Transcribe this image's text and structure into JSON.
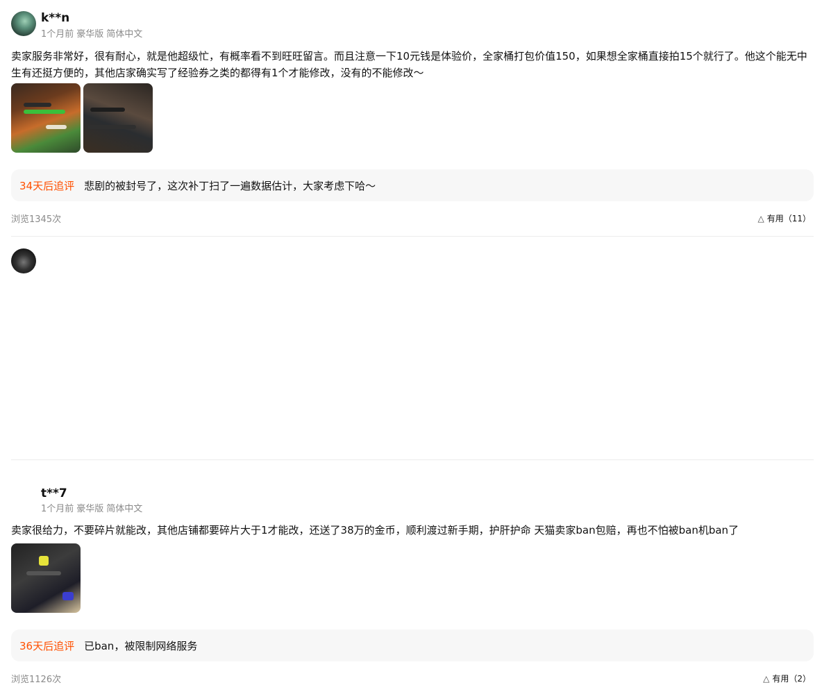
{
  "reviews": [
    {
      "username": "k**n",
      "time": "1个月前",
      "sku": "豪华版",
      "language": "简体中文",
      "content": "卖家服务非常好，很有耐心，就是他超级忙，有概率看不到旺旺留言。而且注意一下10元钱是体验价，全家桶打包价值150，如果想全家桶直接拍15个就行了。他这个能无中生有还挺方便的，其他店家确实写了经验券之类的都得有1个才能修改，没有的不能修改～",
      "followup_label": "34天后追评",
      "followup_text": "悲剧的被封号了，这次补丁扫了一遍数据估计，大家考虑下哈～",
      "views": "浏览1345次",
      "useful": "有用（11）"
    },
    {
      "username": "t**7",
      "time": "1个月前",
      "sku": "豪华版",
      "language": "简体中文",
      "content": "卖家很给力，不要碎片就能改，其他店铺都要碎片大于1才能改，还送了38万的金币，顺利渡过新手期，护肝护命 天猫卖家ban包赔，再也不怕被ban机ban了",
      "followup_label": "36天后追评",
      "followup_text": "已ban，被限制网络服务",
      "views": "浏览1126次",
      "useful": "有用（2）"
    }
  ],
  "colors": {
    "accent": "#ff5000",
    "followup_bg": "#f7f7f7",
    "meta": "#8a8a8a"
  },
  "icons": {
    "useful": "triangle-up-outline-icon"
  }
}
